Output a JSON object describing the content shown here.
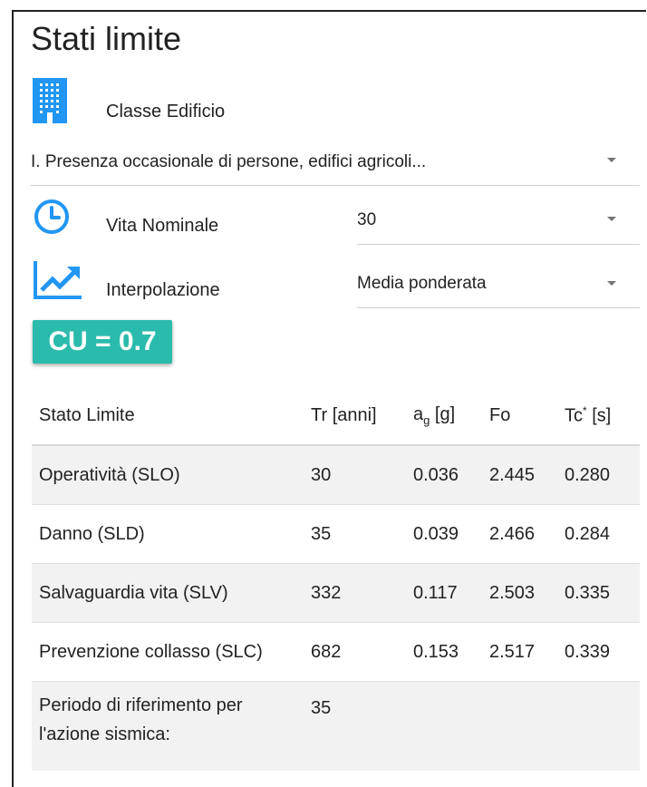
{
  "title": "Stati limite",
  "classe": {
    "label": "Classe Edificio",
    "value": "I. Presenza occasionale di persone, edifici agricoli..."
  },
  "vita": {
    "label": "Vita Nominale",
    "value": "30"
  },
  "interp": {
    "label": "Interpolazione",
    "value": "Media ponderata"
  },
  "cu": "CU = 0.7",
  "table": {
    "headers": {
      "stato": "Stato Limite",
      "tr": "Tr [anni]",
      "ag_base": "a",
      "ag_sub": "g",
      "ag_unit": " [g]",
      "fo": "Fo",
      "tc_base": "Tc",
      "tc_sup": "*",
      "tc_unit": " [s]"
    },
    "rows": [
      {
        "stato": "Operatività (SLO)",
        "tr": "30",
        "ag": "0.036",
        "fo": "2.445",
        "tc": "0.280"
      },
      {
        "stato": "Danno (SLD)",
        "tr": "35",
        "ag": "0.039",
        "fo": "2.466",
        "tc": "0.284"
      },
      {
        "stato": "Salvaguardia vita (SLV)",
        "tr": "332",
        "ag": "0.117",
        "fo": "2.503",
        "tc": "0.335"
      },
      {
        "stato": "Prevenzione collasso (SLC)",
        "tr": "682",
        "ag": "0.153",
        "fo": "2.517",
        "tc": "0.339"
      }
    ],
    "periodo": {
      "label_line1": "Periodo di riferimento per",
      "label_line2": "l'azione sismica:",
      "value": "35"
    }
  },
  "colors": {
    "accent": "#2196f3",
    "badge": "#2bbbad",
    "row_alt": "#f2f2f2"
  },
  "icons": {
    "classe": "building-icon",
    "vita": "clock-icon",
    "interp": "trending-up-icon"
  }
}
